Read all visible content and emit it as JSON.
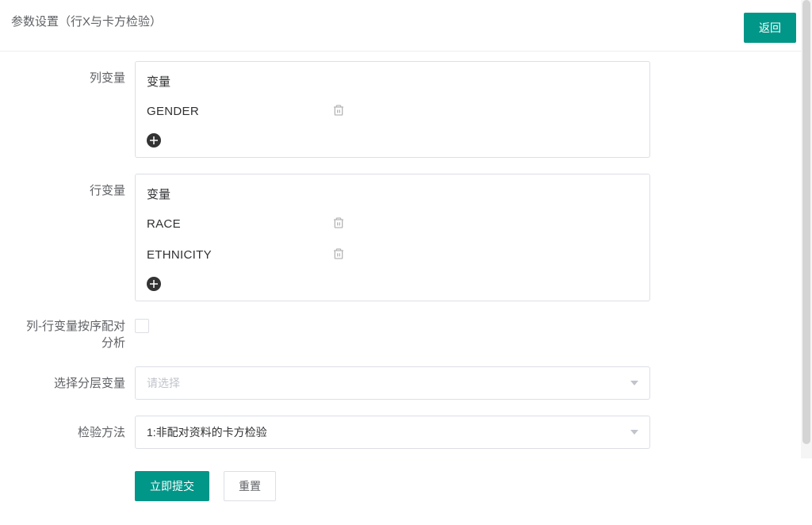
{
  "header": {
    "title": "参数设置（行X与卡方检验）",
    "back_label": "返回"
  },
  "form": {
    "col_var": {
      "label": "列变量",
      "box_header": "变量",
      "items": [
        {
          "name": "GENDER"
        }
      ]
    },
    "row_var": {
      "label": "行变量",
      "box_header": "变量",
      "items": [
        {
          "name": "RACE"
        },
        {
          "name": "ETHNICITY"
        }
      ]
    },
    "pair_analysis": {
      "label": "列-行变量按序配对分析",
      "checked": false
    },
    "strata": {
      "label": "选择分层变量",
      "placeholder": "请选择",
      "value": ""
    },
    "method": {
      "label": "检验方法",
      "value": "1:非配对资料的卡方检验"
    },
    "actions": {
      "submit_label": "立即提交",
      "reset_label": "重置"
    }
  }
}
